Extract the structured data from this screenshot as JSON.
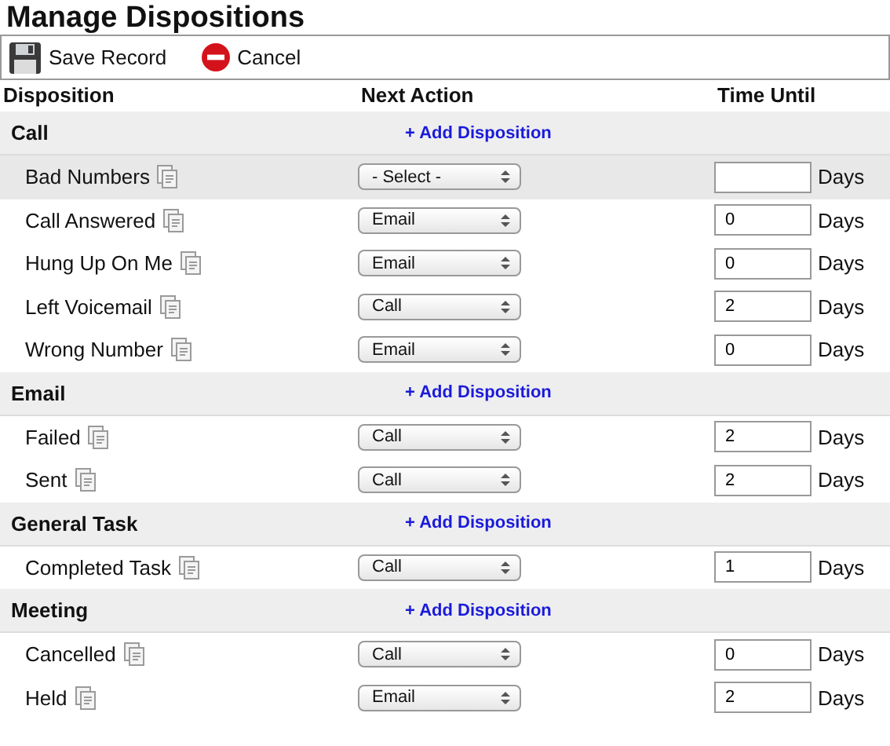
{
  "title": "Manage Dispositions",
  "toolbar": [
    {
      "kind": "save",
      "label": "Save Record"
    },
    {
      "kind": "cancel",
      "label": "Cancel"
    }
  ],
  "columns": [
    "Disposition",
    "Next Action",
    "Time Until"
  ],
  "groups": [
    {
      "name": "Call",
      "add_label": "+ Add Disposition",
      "rows": [
        {
          "name": "Bad Numbers",
          "action": "- Select -",
          "time": "",
          "unit": "Days",
          "selected": true
        },
        {
          "name": "Call Answered",
          "action": "Email",
          "time": "0",
          "unit": "Days",
          "selected": false
        },
        {
          "name": "Hung Up On Me",
          "action": "Email",
          "time": "0",
          "unit": "Days",
          "selected": false
        },
        {
          "name": "Left Voicemail",
          "action": "Call",
          "time": "2",
          "unit": "Days",
          "selected": false
        },
        {
          "name": "Wrong Number",
          "action": "Email",
          "time": "0",
          "unit": "Days",
          "selected": false
        }
      ]
    },
    {
      "name": "Email",
      "add_label": "+ Add Disposition",
      "rows": [
        {
          "name": "Failed",
          "action": "Call",
          "time": "2",
          "unit": "Days",
          "selected": false
        },
        {
          "name": "Sent",
          "action": "Call",
          "time": "2",
          "unit": "Days",
          "selected": false
        }
      ]
    },
    {
      "name": "General Task",
      "add_label": "+ Add Disposition",
      "rows": [
        {
          "name": "Completed Task",
          "action": "Call",
          "time": "1",
          "unit": "Days",
          "selected": false
        }
      ]
    },
    {
      "name": "Meeting",
      "add_label": "+ Add Disposition",
      "rows": [
        {
          "name": "Cancelled",
          "action": "Call",
          "time": "0",
          "unit": "Days",
          "selected": false
        },
        {
          "name": "Held",
          "action": "Email",
          "time": "2",
          "unit": "Days",
          "selected": false
        }
      ]
    }
  ]
}
